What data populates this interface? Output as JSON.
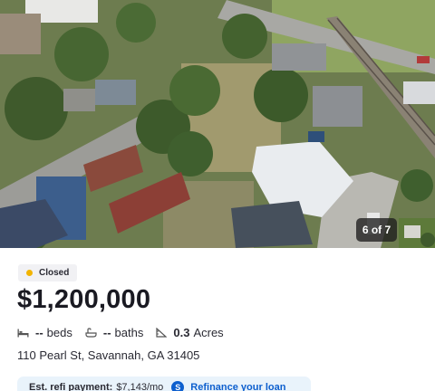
{
  "gallery": {
    "counter": "6 of 7"
  },
  "listing": {
    "status": "Closed",
    "price": "$1,200,000",
    "beds": "--",
    "beds_label": "beds",
    "baths": "--",
    "baths_label": "baths",
    "lot": "0.3",
    "lot_unit": "Acres",
    "address": "110 Pearl St, Savannah, GA 31405"
  },
  "refi": {
    "label": "Est. refi payment:",
    "value": "$7,143/mo",
    "link": "Refinance your loan"
  },
  "colors": {
    "status_dot": "#f2b400",
    "accent": "#0d5fce",
    "refi_bg": "#e9f3fb"
  }
}
